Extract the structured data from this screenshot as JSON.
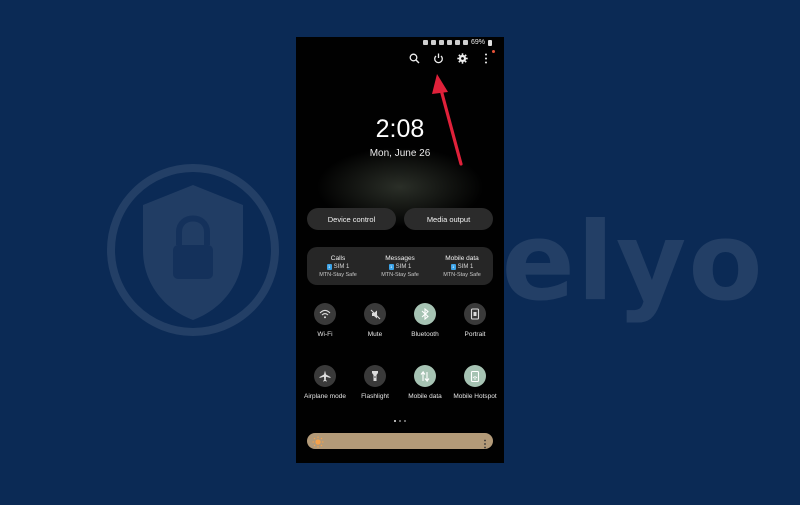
{
  "watermark": {
    "word": "Safelyo"
  },
  "status_bar": {
    "battery": "69%"
  },
  "top_icons": [
    "search-icon",
    "power-icon",
    "gear-icon",
    "more-vertical-icon"
  ],
  "lock": {
    "time": "2:08",
    "date": "Mon, June 26"
  },
  "pills": {
    "device_control": "Device control",
    "media_output": "Media output"
  },
  "sim_panel": [
    {
      "title": "Calls",
      "sim": "SIM 1",
      "network": "MTN-Stay Safe"
    },
    {
      "title": "Messages",
      "sim": "SIM 1",
      "network": "MTN-Stay Safe"
    },
    {
      "title": "Mobile data",
      "sim": "SIM 1",
      "network": "MTN-Stay Safe"
    }
  ],
  "sim_badge": "1",
  "tiles": [
    {
      "label": "Wi-Fi",
      "icon": "wifi-icon",
      "state": "off"
    },
    {
      "label": "Mute",
      "icon": "mute-icon",
      "state": "off"
    },
    {
      "label": "Bluetooth",
      "icon": "bluetooth-icon",
      "state": "on"
    },
    {
      "label": "Portrait",
      "icon": "portrait-icon",
      "state": "off"
    },
    {
      "label": "Airplane mode",
      "icon": "airplane-icon",
      "state": "off"
    },
    {
      "label": "Flashlight",
      "icon": "flashlight-icon",
      "state": "off"
    },
    {
      "label": "Mobile data",
      "icon": "mobile-data-icon",
      "state": "on"
    },
    {
      "label": "Mobile Hotspot",
      "icon": "hotspot-icon",
      "state": "on"
    }
  ],
  "colors": {
    "background": "#0b2a55",
    "arrow": "#e0213a",
    "tile_on": "#a6c3b3",
    "brightness": "#b39a78"
  }
}
